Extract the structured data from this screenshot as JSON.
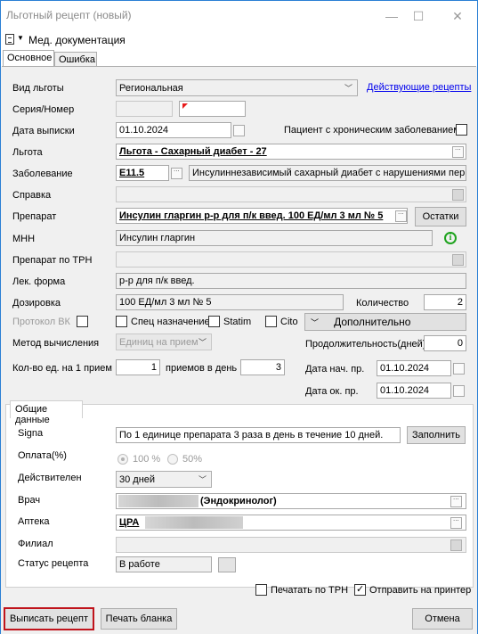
{
  "window": {
    "title": "Льготный рецепт (новый)",
    "minimize": "—",
    "maximize": "☐",
    "close": "✕"
  },
  "menu": {
    "label": "Мед. документация"
  },
  "tabs": [
    "Основное",
    "Ошибка"
  ],
  "form": {
    "vid_lgoty_label": "Вид льготы",
    "vid_lgoty_value": "Региональная",
    "active_recipes_link": "Действующие рецепты",
    "seria_label": "Серия/Номер",
    "data_vypiski_label": "Дата выписки",
    "data_vypiski_value": "01.10.2024",
    "chronic_label": "Пациент с хроническим заболеванием",
    "lgota_label": "Льгота",
    "lgota_value": "Льгота - Сахарный диабет - 27",
    "zabolevanie_label": "Заболевание",
    "zabolevanie_code": "E11.5",
    "zabolevanie_text": "Инсулиннезависимый сахарный диабет с нарушениями перифер",
    "spravka_label": "Справка",
    "preparat_label": "Препарат",
    "preparat_value": "Инсулин гларгин р-р для п/к введ. 100 ЕД/мл 3 мл № 5",
    "ostatki_button": "Остатки",
    "mnn_label": "МНН",
    "mnn_value": "Инсулин гларгин",
    "preparat_trn_label": "Препарат по ТРН",
    "lek_forma_label": "Лек. форма",
    "lek_forma_value": "р-р для п/к введ.",
    "dozirovka_label": "Дозировка",
    "dozirovka_value": "100 ЕД/мл 3 мл № 5",
    "kolichestvo_label": "Количество",
    "kolichestvo_value": "2",
    "protokol_label": "Протокол ВК",
    "spec_label": "Спец назначение",
    "statim_label": "Statim",
    "cito_label": "Cito",
    "dopolnitelno_button": "Дополнительно",
    "metod_label": "Метод вычисления",
    "metod_value": "Единиц на прием",
    "prodolzh_label": "Продолжительность(дней)",
    "prodolzh_value": "0",
    "kolvo_label": "Кол-во ед. на 1 прием",
    "kolvo_value": "1",
    "priemov_label": "приемов в день",
    "priemov_value": "3",
    "data_nach_label": "Дата нач. пр.",
    "data_nach_value": "01.10.2024",
    "data_ok_label": "Дата ок. пр.",
    "data_ok_value": "01.10.2024"
  },
  "common": {
    "tab_label": "Общие данные",
    "signa_label": "Signa",
    "signa_value": "По 1 единице препарата 3 раза в день в течение 10 дней.",
    "zapolnit_button": "Заполнить",
    "oplata_label": "Оплата(%)",
    "oplata_100": "100 %",
    "oplata_50": "50%",
    "deystv_label": "Действителен",
    "deystv_value": "30 дней",
    "vrach_label": "Врач",
    "vrach_value": "(Эндокринолог)",
    "apteka_label": "Аптека",
    "apteka_value": "ЦРА",
    "filial_label": "Филиал",
    "status_label": "Статус рецепта",
    "status_value": "В работе"
  },
  "footer": {
    "print_trn_label": "Печатать по ТРН",
    "send_printer_label": "Отправить на принтер",
    "write_button": "Выписать рецепт",
    "print_blank_button": "Печать бланка",
    "cancel_button": "Отмена"
  },
  "colors": {
    "accent_link": "#0000ee",
    "primary_outline": "#c0141c",
    "info_icon": "#1ea31e",
    "window_border": "#2a7fd4"
  }
}
